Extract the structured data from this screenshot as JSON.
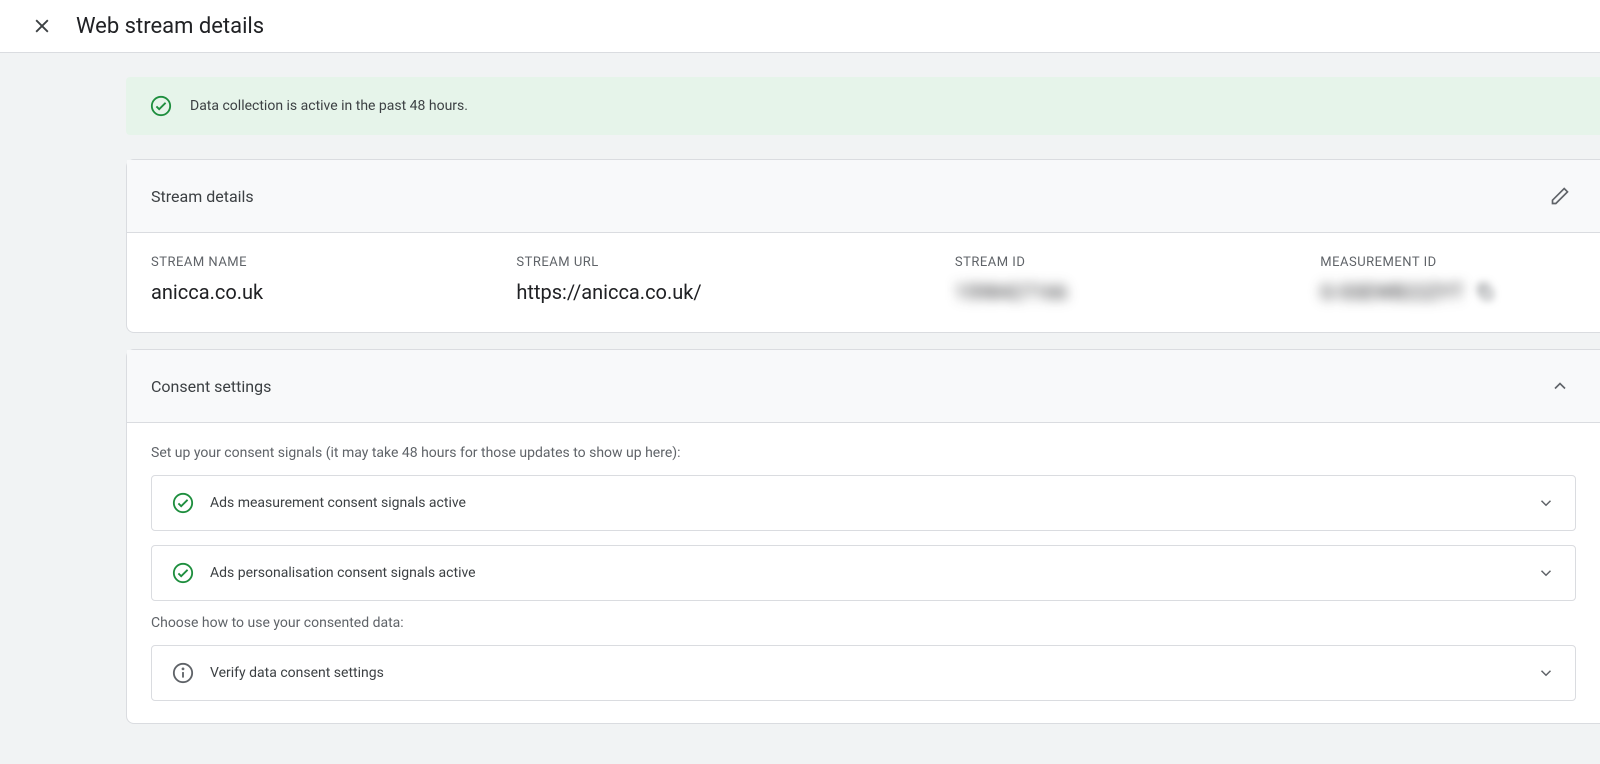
{
  "header": {
    "title": "Web stream details"
  },
  "banner": {
    "text": "Data collection is active in the past 48 hours."
  },
  "streamDetails": {
    "title": "Stream details",
    "labels": {
      "name": "STREAM NAME",
      "url": "STREAM URL",
      "id": "STREAM ID",
      "measurement": "MEASUREMENT ID"
    },
    "values": {
      "name": "anicca.co.uk",
      "url": "https://anicca.co.uk/",
      "id": "1598427166",
      "measurement": "G-SSEWB22ZYT"
    }
  },
  "consent": {
    "title": "Consent settings",
    "intro": "Set up your consent signals (it may take 48 hours for those updates to show up here):",
    "rows": {
      "adsMeasurement": "Ads measurement consent signals active",
      "adsPersonalisation": "Ads personalisation consent signals active"
    },
    "chooseText": "Choose how to use your consented data:",
    "verify": "Verify data consent settings"
  }
}
